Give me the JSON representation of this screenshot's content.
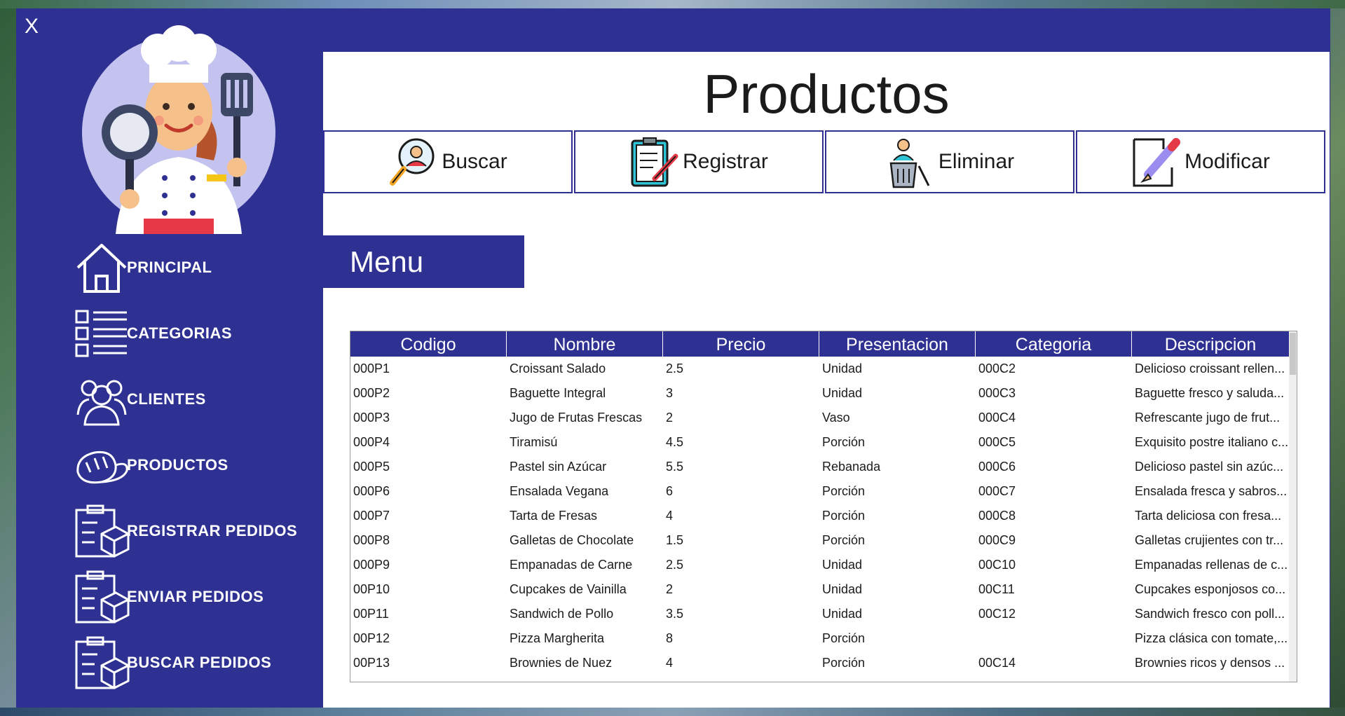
{
  "window": {
    "close_label": "X"
  },
  "nav": {
    "items": [
      {
        "label": "PRINCIPAL",
        "icon": "home-icon"
      },
      {
        "label": "CATEGORIAS",
        "icon": "checklist-icon"
      },
      {
        "label": "CLIENTES",
        "icon": "users-icon"
      },
      {
        "label": "PRODUCTOS",
        "icon": "bread-icon"
      },
      {
        "label": "REGISTRAR PEDIDOS",
        "icon": "clipboard-box-icon"
      },
      {
        "label": "ENVIAR PEDIDOS",
        "icon": "clipboard-box-icon"
      },
      {
        "label": "BUSCAR PEDIDOS",
        "icon": "clipboard-box-icon"
      }
    ]
  },
  "page": {
    "title": "Productos",
    "section_label": "Menu"
  },
  "actions": [
    {
      "label": "Buscar",
      "icon": "search-user-icon"
    },
    {
      "label": "Registrar",
      "icon": "clipboard-pen-icon"
    },
    {
      "label": "Eliminar",
      "icon": "trash-user-icon"
    },
    {
      "label": "Modificar",
      "icon": "edit-pencil-icon"
    }
  ],
  "table": {
    "columns": [
      "Codigo",
      "Nombre",
      "Precio",
      "Presentacion",
      "Categoria",
      "Descripcion"
    ],
    "rows": [
      [
        "000P1",
        "Croissant Salado",
        "2.5",
        "Unidad",
        "000C2",
        "Delicioso croissant rellen..."
      ],
      [
        "000P2",
        "Baguette Integral",
        "3",
        "Unidad",
        "000C3",
        "Baguette fresco y saluda..."
      ],
      [
        "000P3",
        "Jugo de Frutas Frescas",
        "2",
        "Vaso",
        "000C4",
        "Refrescante jugo de frut..."
      ],
      [
        "000P4",
        "Tiramisú",
        "4.5",
        "Porción",
        "000C5",
        "Exquisito postre italiano c..."
      ],
      [
        "000P5",
        "Pastel sin Azúcar",
        "5.5",
        "Rebanada",
        "000C6",
        "Delicioso pastel sin azúc..."
      ],
      [
        "000P6",
        "Ensalada Vegana",
        "6",
        "Porción",
        "000C7",
        "Ensalada fresca y sabros..."
      ],
      [
        "000P7",
        "Tarta de Fresas",
        "4",
        "Porción",
        "000C8",
        "Tarta deliciosa con fresa..."
      ],
      [
        "000P8",
        "Galletas de Chocolate",
        "1.5",
        "Porción",
        "000C9",
        "Galletas crujientes con tr..."
      ],
      [
        "000P9",
        "Empanadas de Carne",
        "2.5",
        "Unidad",
        "00C10",
        "Empanadas rellenas de c..."
      ],
      [
        "00P10",
        "Cupcakes de Vainilla",
        "2",
        "Unidad",
        "00C11",
        "Cupcakes esponjosos co..."
      ],
      [
        "00P11",
        "Sandwich de Pollo",
        "3.5",
        "Unidad",
        "00C12",
        "Sandwich fresco con poll..."
      ],
      [
        "00P12",
        "Pizza Margherita",
        "8",
        "Porción",
        "",
        "Pizza clásica con tomate,..."
      ],
      [
        "00P13",
        "Brownies de Nuez",
        "4",
        "Porción",
        "00C14",
        "Brownies ricos y densos ..."
      ]
    ]
  },
  "colors": {
    "brand": "#2e3092",
    "surface": "#ffffff",
    "text": "#1b1b1b"
  }
}
